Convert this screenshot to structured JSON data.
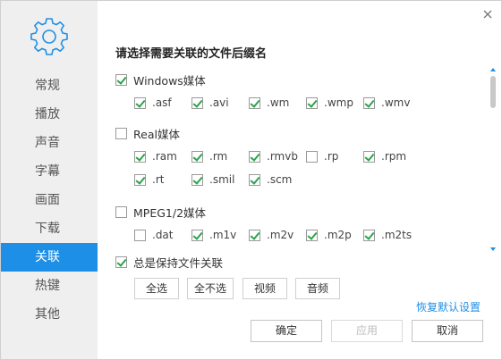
{
  "sidebar": {
    "items": [
      {
        "label": "常规"
      },
      {
        "label": "播放"
      },
      {
        "label": "声音"
      },
      {
        "label": "字幕"
      },
      {
        "label": "画面"
      },
      {
        "label": "下载"
      },
      {
        "label": "关联"
      },
      {
        "label": "热键"
      },
      {
        "label": "其他"
      }
    ],
    "active_index": 6
  },
  "section_title": "请选择需要关联的文件后缀名",
  "groups": [
    {
      "label": "Windows媒体",
      "checked": true,
      "rows": [
        [
          {
            "ext": ".asf",
            "checked": true
          },
          {
            "ext": ".avi",
            "checked": true
          },
          {
            "ext": ".wm",
            "checked": true
          },
          {
            "ext": ".wmp",
            "checked": true
          },
          {
            "ext": ".wmv",
            "checked": true
          }
        ]
      ]
    },
    {
      "label": "Real媒体",
      "checked": false,
      "rows": [
        [
          {
            "ext": ".ram",
            "checked": true
          },
          {
            "ext": ".rm",
            "checked": true
          },
          {
            "ext": ".rmvb",
            "checked": true
          },
          {
            "ext": ".rp",
            "checked": false
          },
          {
            "ext": ".rpm",
            "checked": true
          }
        ],
        [
          {
            "ext": ".rt",
            "checked": true
          },
          {
            "ext": ".smil",
            "checked": true
          },
          {
            "ext": ".scm",
            "checked": true
          }
        ]
      ]
    },
    {
      "label": "MPEG1/2媒体",
      "checked": false,
      "rows": [
        [
          {
            "ext": ".dat",
            "checked": false
          },
          {
            "ext": ".m1v",
            "checked": true
          },
          {
            "ext": ".m2v",
            "checked": true
          },
          {
            "ext": ".m2p",
            "checked": true
          },
          {
            "ext": ".m2ts",
            "checked": true
          }
        ]
      ]
    }
  ],
  "always_keep": {
    "label": "总是保持文件关联",
    "checked": true
  },
  "quick_buttons": {
    "select_all": "全选",
    "select_none": "全不选",
    "video": "视频",
    "audio": "音频"
  },
  "restore_link": "恢复默认设置",
  "footer": {
    "ok": "确定",
    "apply": "应用",
    "cancel": "取消"
  },
  "colors": {
    "accent": "#1e8fe6",
    "check": "#2aa34a",
    "sidebar_bg": "#efefef"
  },
  "icons": {
    "settings": "gear-icon",
    "close": "close-icon",
    "scroll_up": "arrow-up-icon",
    "scroll_down": "arrow-down-icon"
  }
}
